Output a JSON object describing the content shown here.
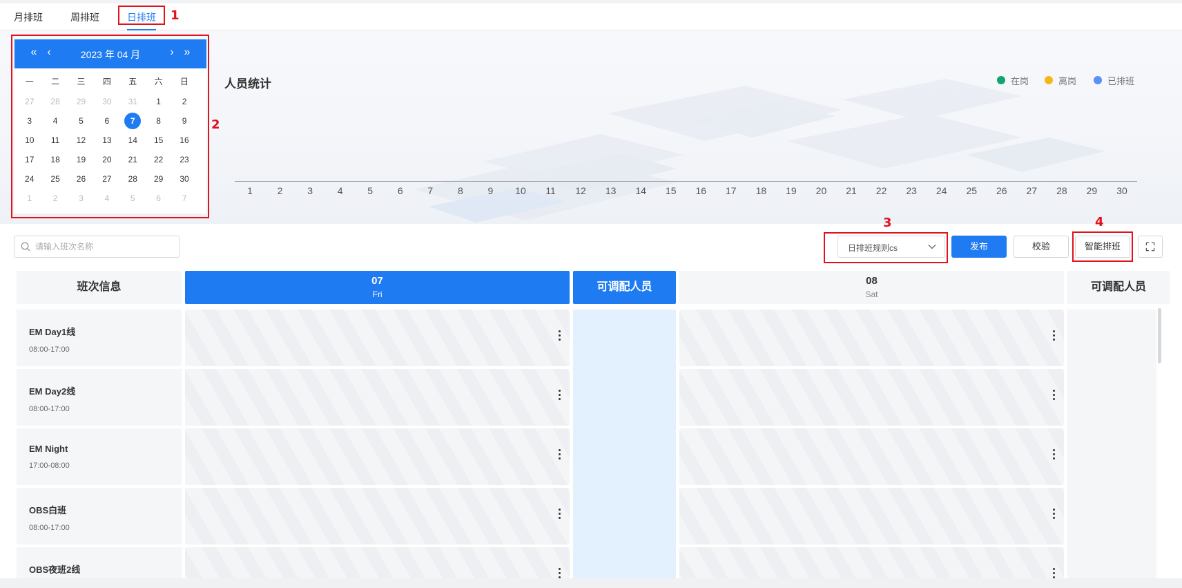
{
  "tabs": [
    {
      "label": "月排班",
      "active": false
    },
    {
      "label": "周排班",
      "active": false
    },
    {
      "label": "日排班",
      "active": true
    }
  ],
  "annotations": [
    "1",
    "2",
    "3",
    "4"
  ],
  "calendar": {
    "title": "2023 年 04 月",
    "weekdays": [
      "一",
      "二",
      "三",
      "四",
      "五",
      "六",
      "日"
    ],
    "days": [
      {
        "d": "27",
        "muted": true
      },
      {
        "d": "28",
        "muted": true
      },
      {
        "d": "29",
        "muted": true
      },
      {
        "d": "30",
        "muted": true
      },
      {
        "d": "31",
        "muted": true
      },
      {
        "d": "1"
      },
      {
        "d": "2"
      },
      {
        "d": "3"
      },
      {
        "d": "4"
      },
      {
        "d": "5"
      },
      {
        "d": "6"
      },
      {
        "d": "7",
        "selected": true
      },
      {
        "d": "8"
      },
      {
        "d": "9"
      },
      {
        "d": "10"
      },
      {
        "d": "11"
      },
      {
        "d": "12"
      },
      {
        "d": "13"
      },
      {
        "d": "14"
      },
      {
        "d": "15"
      },
      {
        "d": "16"
      },
      {
        "d": "17"
      },
      {
        "d": "18"
      },
      {
        "d": "19"
      },
      {
        "d": "20"
      },
      {
        "d": "21"
      },
      {
        "d": "22"
      },
      {
        "d": "23"
      },
      {
        "d": "24"
      },
      {
        "d": "25"
      },
      {
        "d": "26"
      },
      {
        "d": "27"
      },
      {
        "d": "28"
      },
      {
        "d": "29"
      },
      {
        "d": "30"
      },
      {
        "d": "1",
        "muted": true
      },
      {
        "d": "2",
        "muted": true
      },
      {
        "d": "3",
        "muted": true
      },
      {
        "d": "4",
        "muted": true
      },
      {
        "d": "5",
        "muted": true
      },
      {
        "d": "6",
        "muted": true
      },
      {
        "d": "7",
        "muted": true
      }
    ]
  },
  "stats": {
    "title": "人员统计",
    "legend": [
      {
        "label": "在岗",
        "color": "#13a36b"
      },
      {
        "label": "离岗",
        "color": "#f6b61b"
      },
      {
        "label": "已排班",
        "color": "#5b8ff9"
      }
    ],
    "x_ticks": [
      "1",
      "2",
      "3",
      "4",
      "5",
      "6",
      "7",
      "8",
      "9",
      "10",
      "11",
      "12",
      "13",
      "14",
      "15",
      "16",
      "17",
      "18",
      "19",
      "20",
      "21",
      "22",
      "23",
      "24",
      "25",
      "26",
      "27",
      "28",
      "29",
      "30"
    ]
  },
  "toolbar": {
    "search_placeholder": "请输入班次名称",
    "rule_select": "日排班规则cs",
    "publish": "发布",
    "validate": "校验",
    "smart": "智能排班"
  },
  "table": {
    "shift_header": "班次信息",
    "day1": {
      "day": "07",
      "weekday": "Fri"
    },
    "day2": {
      "day": "08",
      "weekday": "Sat"
    },
    "available_header": "可调配人员",
    "shifts": [
      {
        "name": "EM Day1线",
        "time": "08:00-17:00"
      },
      {
        "name": "EM Day2线",
        "time": "08:00-17:00"
      },
      {
        "name": "EM Night",
        "time": "17:00-08:00"
      },
      {
        "name": "OBS白班",
        "time": "08:00-17:00"
      },
      {
        "name": "OBS夜班2线",
        "time": ""
      }
    ]
  },
  "colors": {
    "accent": "#1f7bf2",
    "annotation": "#e0121b"
  }
}
